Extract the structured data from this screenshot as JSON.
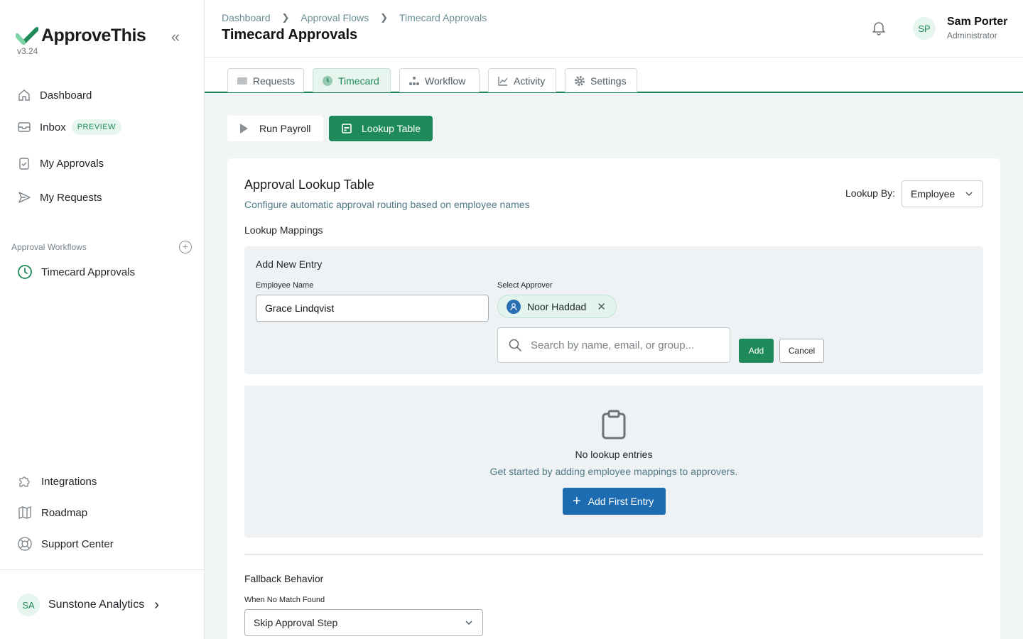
{
  "app": {
    "name": "ApproveThis",
    "version": "v3.24"
  },
  "sidebar": {
    "nav": [
      {
        "label": "Dashboard",
        "icon": "home-icon"
      },
      {
        "label": "Inbox",
        "icon": "inbox-icon",
        "badge": "PREVIEW"
      },
      {
        "label": "My Approvals",
        "icon": "clipboard-check-icon"
      },
      {
        "label": "My Requests",
        "icon": "send-icon"
      }
    ],
    "workflows_section": "Approval Workflows",
    "workflows": [
      {
        "label": "Timecard Approvals",
        "icon": "clock-icon"
      }
    ],
    "bottom": [
      {
        "label": "Integrations",
        "icon": "puzzle-icon"
      },
      {
        "label": "Roadmap",
        "icon": "map-icon"
      },
      {
        "label": "Support Center",
        "icon": "lifebuoy-icon"
      }
    ],
    "org": {
      "initials": "SA",
      "name": "Sunstone Analytics"
    }
  },
  "header": {
    "breadcrumbs": [
      "Dashboard",
      "Approval Flows",
      "Timecard Approvals"
    ],
    "title": "Timecard Approvals",
    "user": {
      "initials": "SP",
      "name": "Sam Porter",
      "role": "Administrator"
    }
  },
  "tabs": [
    {
      "label": "Requests",
      "icon": "inbox-icon",
      "active": false
    },
    {
      "label": "Timecard",
      "icon": "clock-icon",
      "active": true
    },
    {
      "label": "Workflow",
      "icon": "workflow-icon",
      "active": false
    },
    {
      "label": "Activity",
      "icon": "chart-line-icon",
      "active": false
    },
    {
      "label": "Settings",
      "icon": "gear-icon",
      "active": false
    }
  ],
  "actions": {
    "run_payroll": "Run Payroll",
    "lookup_table": "Lookup Table"
  },
  "card": {
    "title": "Approval Lookup Table",
    "subtitle": "Configure automatic approval routing based on employee names",
    "lookup_by_label": "Lookup By:",
    "lookup_by_value": "Employee",
    "mappings_label": "Lookup Mappings",
    "entry": {
      "title": "Add New Entry",
      "employee_label": "Employee Name",
      "employee_value": "Grace Lindqvist",
      "approver_label": "Select Approver",
      "approver_chip": "Noor Haddad",
      "search_placeholder": "Search by name, email, or group...",
      "add": "Add",
      "cancel": "Cancel"
    },
    "empty": {
      "title": "No lookup entries",
      "subtitle": "Get started by adding employee mappings to approvers.",
      "button": "Add First Entry"
    },
    "fallback": {
      "title": "Fallback Behavior",
      "label": "When No Match Found",
      "value": "Skip Approval Step"
    }
  },
  "colors": {
    "brand_green": "#1e8a5a",
    "primary_blue": "#1d6bb0",
    "page_bg": "#f1f5f6"
  }
}
